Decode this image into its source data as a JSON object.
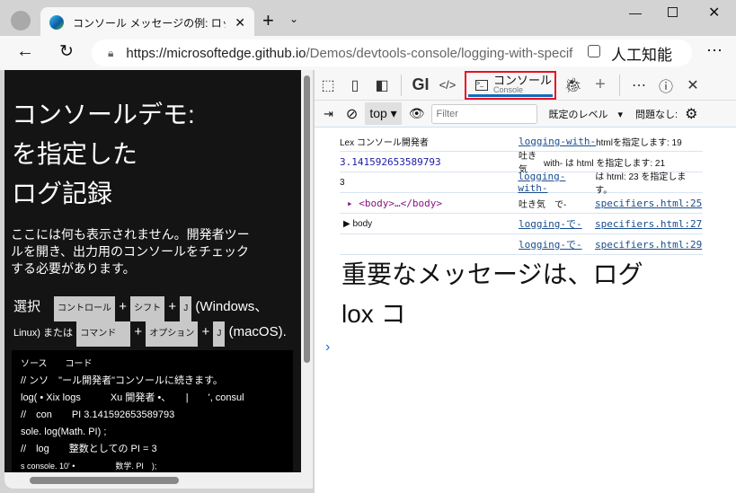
{
  "browser": {
    "tab_title": "コンソール メッセージの例: ロック",
    "url_host": "https://microsoftedge.github.io",
    "url_path": "/Demos/devtools-console/logging-with-specif",
    "translate_label": "人工知能"
  },
  "page": {
    "heading": [
      "コンソールデモ:",
      "を指定した",
      "ログ記録"
    ],
    "intro": "ここには何も表示されません。開発者ツールを開き、出力用のコンソールをチェックする必要があります。",
    "shortcut": {
      "select": "選択",
      "ctrl": "コントロール",
      "shift": "シフト",
      "j": "J",
      "windows": "(Windows、",
      "linux": "Linux) または",
      "cmd": "コマンド",
      "option": "オプション",
      "mac": "(macOS).",
      "plus": "+"
    },
    "code_lines": [
      "ソース　　コード",
      "// ンソ　\"ール開発者\"コンソールに続きます。",
      "log( • Xix logs　　　Xu 開発者 •、　　|　　', consul",
      "//　con　　PI 3.141592653589793",
      "sole. log(Math. PI) ;",
      "//　log　　整数としての PI = 3",
      "s console. 10' •　　　　　数学. PI　);"
    ]
  },
  "devtools": {
    "tabs": {
      "gi": "GI",
      "console": "コンソール",
      "console_sub": "Console"
    },
    "context": "top",
    "filter_placeholder": "Filter",
    "level": "既定のレベル",
    "issues": "問題なし:",
    "rows": [
      {
        "msg": "Lex コンソール開発者",
        "src1": "logging-with-",
        "src2": "htmlを指定します: 19"
      },
      {
        "msg": "3.141592653589793",
        "src1": "吐き気",
        "src2": "with- は html を指定します: 21"
      },
      {
        "msg": "3",
        "src1": "logging-with-",
        "src2": "は html: 23 を指定します。"
      },
      {
        "msg": "<body>…</body>",
        "src1": "吐き気　で-",
        "src2": "specifiers.html:25"
      },
      {
        "msg": "body",
        "src1": "logging-で-",
        "src2": "specifiers.html:27"
      },
      {
        "msg": "",
        "src1": "logging-で-",
        "src2": "specifiers.html:29"
      }
    ],
    "big_message": "重要なメッセージは、ログ lox コ",
    "prompt": "›"
  }
}
